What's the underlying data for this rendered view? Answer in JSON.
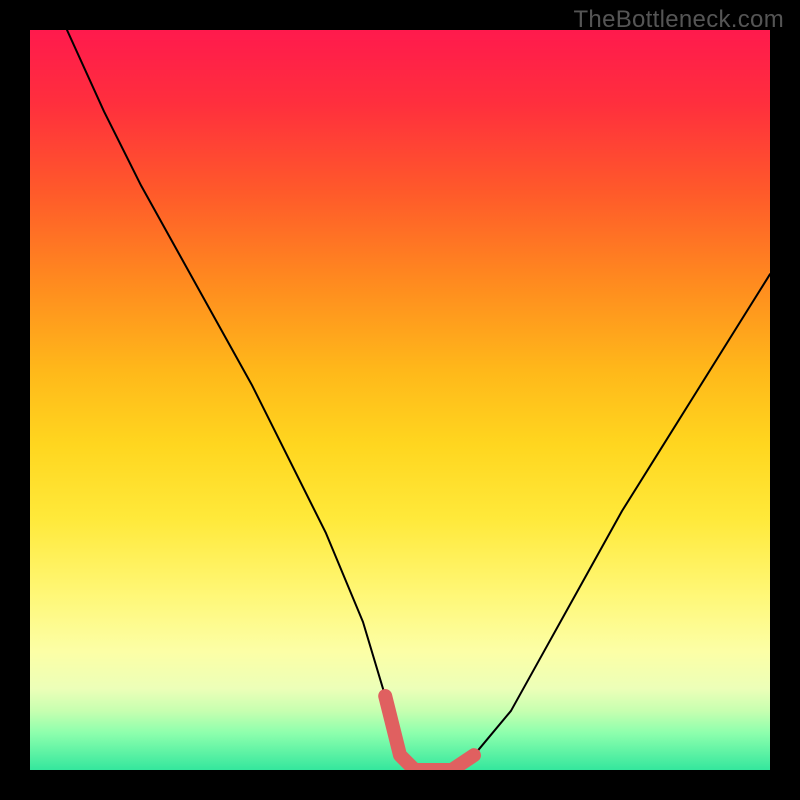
{
  "watermark": "TheBottleneck.com",
  "chart_data": {
    "type": "line",
    "title": "",
    "xlabel": "",
    "ylabel": "",
    "xlim": [
      0,
      100
    ],
    "ylim": [
      0,
      100
    ],
    "series": [
      {
        "name": "curve",
        "x": [
          5,
          10,
          15,
          20,
          25,
          30,
          35,
          40,
          45,
          48,
          50,
          52,
          55,
          57,
          60,
          65,
          70,
          75,
          80,
          85,
          90,
          95,
          100
        ],
        "values": [
          100,
          89,
          79,
          70,
          61,
          52,
          42,
          32,
          20,
          10,
          2,
          0,
          0,
          0,
          2,
          8,
          17,
          26,
          35,
          43,
          51,
          59,
          67
        ]
      },
      {
        "name": "bottom-highlight",
        "x": [
          48,
          50,
          52,
          55,
          57,
          60
        ],
        "values": [
          10,
          2,
          0,
          0,
          0,
          2
        ]
      }
    ],
    "colors": {
      "curve": "#000000",
      "bottom-highlight": "#e06060",
      "gradient_top": "#ff1a4d",
      "gradient_mid": "#ffd61f",
      "gradient_bottom": "#34e79d",
      "frame": "#000000"
    }
  }
}
